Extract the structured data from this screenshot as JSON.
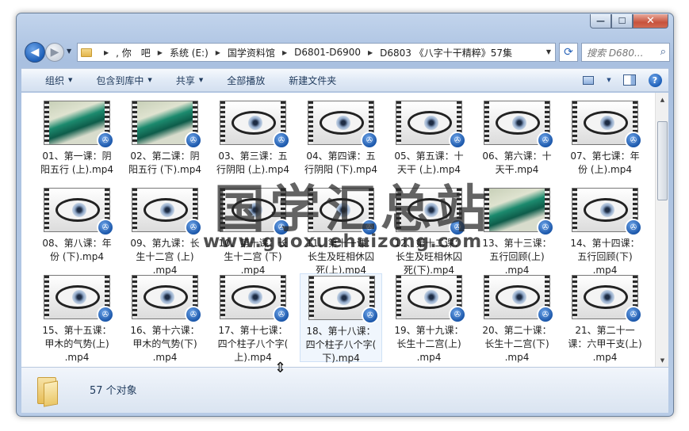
{
  "window": {
    "controls": {
      "minimize": "—",
      "maximize": "☐",
      "close": "✕"
    }
  },
  "nav": {
    "back_glyph": "◀",
    "forward_glyph": "▶",
    "breadcrumbs": [
      ", 你　吧",
      "系统 (E:)",
      "国学资料馆",
      "D6801-D6900",
      "D6803 《八字十干精粹》57集"
    ],
    "refresh_glyph": "⟳",
    "search_placeholder": "搜索 D680..."
  },
  "toolbar": {
    "organize": "组织",
    "include_library": "包含到库中",
    "share": "共享",
    "play_all": "全部播放",
    "new_folder": "新建文件夹"
  },
  "files": [
    {
      "label": "01、第一课：阴\n阳五行 (上).mp4",
      "thumb": "teal"
    },
    {
      "label": "02、第二课：阴\n阳五行 (下).mp4",
      "thumb": "teal"
    },
    {
      "label": "03、第三课：五\n行阴阳 (上).mp4",
      "thumb": "eye"
    },
    {
      "label": "04、第四课：五\n行阴阳 (下).mp4",
      "thumb": "eye"
    },
    {
      "label": "05、第五课：十\n天干 (上).mp4",
      "thumb": "eye"
    },
    {
      "label": "06、第六课：十\n天干.mp4",
      "thumb": "eye"
    },
    {
      "label": "07、第七课：年\n份 (上).mp4",
      "thumb": "eye"
    },
    {
      "label": "08、第八课：年\n份 (下).mp4",
      "thumb": "eye"
    },
    {
      "label": "09、第九课：长\n生十二宫 (上)\n.mp4",
      "thumb": "eye"
    },
    {
      "label": "10、第十课：长\n生十二宫 (下)\n.mp4",
      "thumb": "eye"
    },
    {
      "label": "11、第十一课：\n长生及旺相休囚\n死(上).mp4",
      "thumb": "eye"
    },
    {
      "label": "12、第十二课：\n长生及旺相休囚\n死(下).mp4",
      "thumb": "eye"
    },
    {
      "label": "13、第十三课：\n五行回顾(上)\n.mp4",
      "thumb": "teal"
    },
    {
      "label": "14、第十四课：\n五行回顾(下)\n.mp4",
      "thumb": "eye"
    },
    {
      "label": "15、第十五课：\n甲木的气势(上)\n.mp4",
      "thumb": "eye"
    },
    {
      "label": "16、第十六课：\n甲木的气势(下)\n.mp4",
      "thumb": "eye"
    },
    {
      "label": "17、第十七课：\n四个柱子八个字(\n上).mp4",
      "thumb": "eye"
    },
    {
      "label": "18、第十八课：\n四个柱子八个字(\n下).mp4",
      "thumb": "eye",
      "selected": true
    },
    {
      "label": "19、第十九课：\n长生十二宫(上)\n.mp4",
      "thumb": "eye"
    },
    {
      "label": "20、第二十课：\n长生十二宫(下)\n.mp4",
      "thumb": "eye"
    },
    {
      "label": "21、第二十一\n课：六甲干支(上)\n.mp4",
      "thumb": "eye"
    }
  ],
  "status": {
    "count_text": "57 个对象"
  },
  "watermark": {
    "title": "国学汇总站",
    "url": "www.guoxuehuizong.com"
  },
  "icons": {
    "video_badge": "film-reel-icon",
    "folder": "folder-icon"
  },
  "colors": {
    "accent": "#1d5fb8",
    "toolbar_text": "#1e395b"
  }
}
